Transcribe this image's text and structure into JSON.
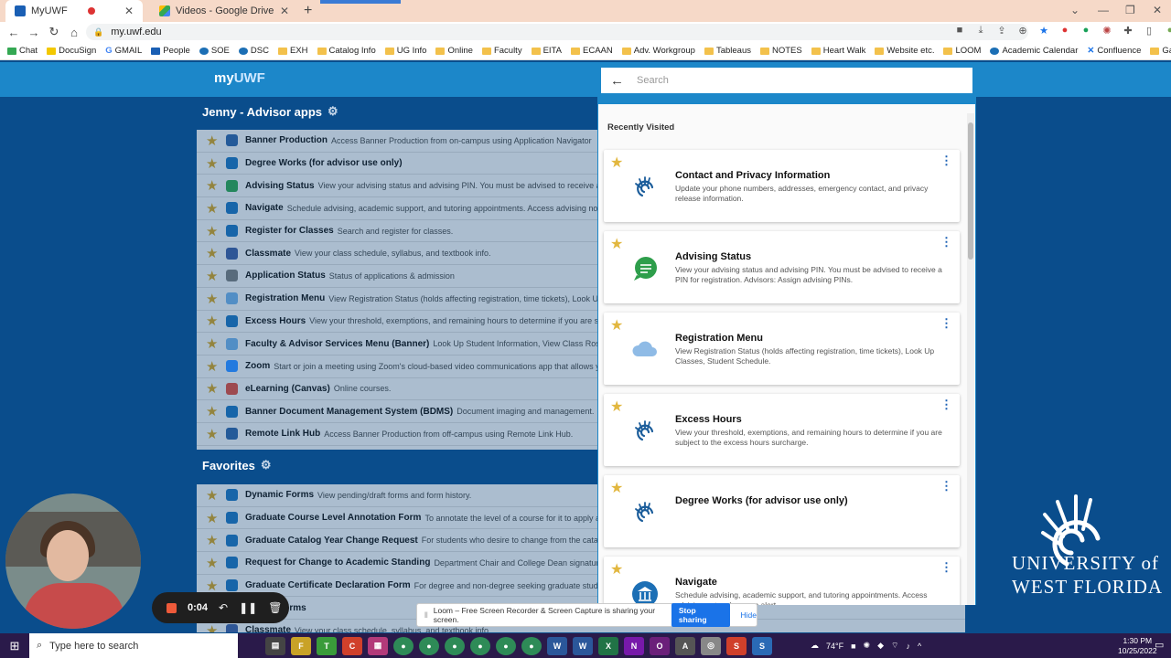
{
  "browser": {
    "tabs": [
      {
        "title": "MyUWF",
        "active": true
      },
      {
        "title": "Videos - Google Drive",
        "active": false
      }
    ],
    "url": "my.uwf.edu",
    "bookmarks": [
      "Chat",
      "DocuSign",
      "GMAIL",
      "People",
      "SOE",
      "DSC",
      "EXH",
      "Catalog Info",
      "UG Info",
      "Online",
      "Faculty",
      "EITA",
      "ECAAN",
      "Adv. Workgroup",
      "Tableaus",
      "NOTES",
      "Heart Walk",
      "Website etc.",
      "LOOM",
      "Academic Calendar",
      "Confluence",
      "Garden"
    ]
  },
  "header": {
    "logo_my": "my",
    "logo_uwf": "UWF"
  },
  "advisor_section": {
    "title": "Jenny - Advisor apps",
    "items": [
      {
        "name": "Banner Production",
        "desc": "Access Banner Production from on-campus using Application Navigator",
        "color": "#2f5f9e"
      },
      {
        "name": "Degree Works (for advisor use only)",
        "desc": "",
        "color": "#1c6fb5"
      },
      {
        "name": "Advising Status",
        "desc": "View your advising status and advising PIN. You must be advised to receive a PIN fo",
        "color": "#2e9e4b"
      },
      {
        "name": "Navigate",
        "desc": "Schedule advising, academic support, and tutoring appointments. Access advising notes. Is",
        "color": "#1c6fb5"
      },
      {
        "name": "Register for Classes",
        "desc": "Search and register for classes.",
        "color": "#1c6fb5"
      },
      {
        "name": "Classmate",
        "desc": "View your class schedule, syllabus, and textbook info.",
        "color": "#3c5a9a"
      },
      {
        "name": "Application Status",
        "desc": "Status of applications & admission",
        "color": "#777777"
      },
      {
        "name": "Registration Menu",
        "desc": "View Registration Status (holds affecting registration, time tickets), Look Up Class",
        "color": "#6ea8dc"
      },
      {
        "name": "Excess Hours",
        "desc": "View your threshold, exemptions, and remaining hours to determine if you are subject t",
        "color": "#1c6fb5"
      },
      {
        "name": "Faculty & Advisor Services Menu (Banner)",
        "desc": "Look Up Student Information, View Class Rosters, View",
        "color": "#6ea8dc"
      },
      {
        "name": "Zoom",
        "desc": "Start or join a meeting using Zoom's cloud-based video communications app that allows you to",
        "color": "#2d8cff"
      },
      {
        "name": "eLearning (Canvas)",
        "desc": "Online courses.",
        "color": "#d64a3a"
      },
      {
        "name": "Banner Document Management System (BDMS)",
        "desc": "Document imaging and management.",
        "color": "#1c6fb5"
      },
      {
        "name": "Remote Link Hub",
        "desc": "Access Banner Production from off-campus using Remote Link Hub.",
        "color": "#2f5f9e"
      }
    ]
  },
  "favorites_section": {
    "title": "Favorites",
    "items": [
      {
        "name": "Dynamic Forms",
        "desc": "View pending/draft forms and form history.",
        "color": "#1c6fb5"
      },
      {
        "name": "Graduate Course Level Annotation Form",
        "desc": "To annotate the level of a course for it to apply appropria",
        "color": "#1c6fb5"
      },
      {
        "name": "Graduate Catalog Year Change Request",
        "desc": "For students who desire to change from the catalog in eff",
        "color": "#1c6fb5"
      },
      {
        "name": "Request for Change to Academic Standing",
        "desc": "Department Chair and College Dean signature require",
        "color": "#1c6fb5"
      },
      {
        "name": "Graduate Certificate Declaration Form",
        "desc": "For degree and non-degree seeking graduate students to de",
        "color": "#1c6fb5"
      },
      {
        "name": "School Forms",
        "desc": "",
        "color": "#1c6fb5"
      },
      {
        "name": "Classmate",
        "desc": "View your class schedule, syllabus, and textbook info.",
        "color": "#3c5a9a"
      }
    ]
  },
  "search": {
    "placeholder": "Search",
    "recent_title": "Recently Visited",
    "cards": [
      {
        "title": "Contact and Privacy Information",
        "desc": "Update your phone numbers, addresses, emergency contact, and privacy release information.",
        "icon": "uwf-swirl-icon"
      },
      {
        "title": "Advising Status",
        "desc": "View your advising status and advising PIN. You must be advised to receive a PIN for registration. Advisors: Assign advising PINs.",
        "icon": "chat-bubble-icon"
      },
      {
        "title": "Registration Menu",
        "desc": "View Registration Status (holds affecting registration, time tickets), Look Up Classes, Student Schedule.",
        "icon": "cloud-icon"
      },
      {
        "title": "Excess Hours",
        "desc": "View your threshold, exemptions, and remaining hours to determine if you are subject to the excess hours surcharge.",
        "icon": "uwf-swirl-icon"
      },
      {
        "title": "Degree Works (for advisor use only)",
        "desc": "",
        "icon": "uwf-swirl-icon"
      },
      {
        "title": "Navigate",
        "desc": "Schedule advising, academic support, and tutoring appointments. Access advising notes. Issue an alert.",
        "icon": "building-icon"
      }
    ]
  },
  "branding": {
    "line1": "UNIVERSITY of",
    "line2": "WEST FLORIDA"
  },
  "recorder": {
    "time": "0:04"
  },
  "share_bar": {
    "message": "Loom – Free Screen Recorder & Screen Capture is sharing your screen.",
    "stop_label": "Stop sharing",
    "hide_label": "Hide"
  },
  "taskbar": {
    "search_placeholder": "Type here to search",
    "weather": "74°F",
    "time": "1:30 PM",
    "date": "10/25/2022"
  }
}
